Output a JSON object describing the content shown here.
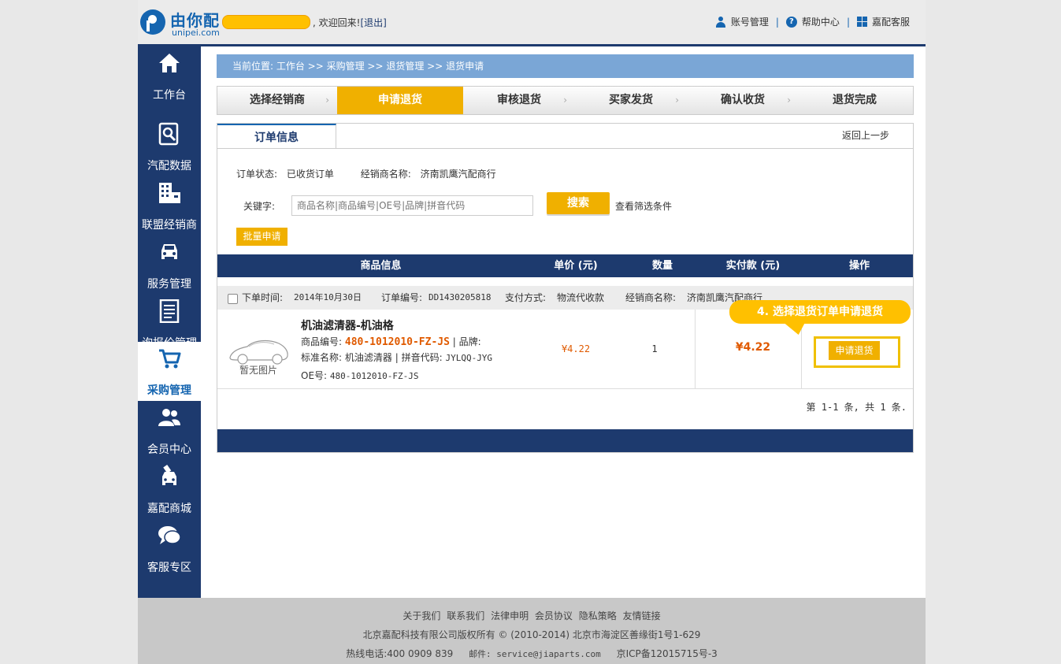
{
  "header": {
    "logo_text": "由你配",
    "logo_sub": "unipei.com",
    "welcome": ", 欢迎回来!",
    "logout": "[退出]",
    "links": [
      "账号管理",
      "帮助中心",
      "嘉配客服"
    ]
  },
  "sidebar": {
    "items": [
      {
        "label": "工作台",
        "icon": "home-icon"
      },
      {
        "label": "汽配数据",
        "icon": "search-doc-icon"
      },
      {
        "label": "联盟经销商",
        "icon": "building-icon"
      },
      {
        "label": "服务管理",
        "icon": "car-icon"
      },
      {
        "label": "询报价管理",
        "icon": "document-list-icon"
      },
      {
        "label": "采购管理",
        "icon": "cart-icon",
        "active": true
      },
      {
        "label": "会员中心",
        "icon": "users-icon"
      },
      {
        "label": "嘉配商城",
        "icon": "car-tag-icon"
      },
      {
        "label": "客服专区",
        "icon": "chat-icon"
      }
    ]
  },
  "breadcrumb": "当前位置: 工作台 >> 采购管理 >> 退货管理 >> 退货申请",
  "steps": [
    {
      "label": "选择经销商"
    },
    {
      "label": "申请退货",
      "active": true
    },
    {
      "label": "审核退货"
    },
    {
      "label": "买家发货"
    },
    {
      "label": "确认收货"
    },
    {
      "label": "退货完成"
    }
  ],
  "panel": {
    "tab": "订单信息",
    "back": "返回上一步",
    "status_label": "订单状态:",
    "status_value": "已收货订单",
    "dealer_label": "经销商名称:",
    "dealer_value": "济南凯鹰汽配商行",
    "keyword_label": "关键字:",
    "keyword_placeholder": "商品名称|商品编号|OE号|品牌|拼音代码",
    "search_btn": "搜索",
    "filter_link": "查看筛选条件",
    "batch_btn": "批量申请"
  },
  "table": {
    "headers": [
      "商品信息",
      "单价 (元)",
      "数量",
      "实付款 (元)",
      "操作"
    ]
  },
  "order": {
    "time_label": "下单时间:",
    "time_value": "2014年10月30日",
    "no_label": "订单编号:",
    "no_value": "DD1430205818",
    "pay_label": "支付方式:",
    "pay_value": "物流代收款",
    "dealer_label": "经销商名称:",
    "dealer_value": "济南凯鹰汽配商行"
  },
  "item": {
    "no_image": "暂无图片",
    "name": "机油滤清器-机油格",
    "code_label": "商品编号:",
    "code_value": "480-1012010-FZ-JS",
    "brand_label": "| 品牌:",
    "std_label": "标准名称:",
    "std_value": "机油滤清器",
    "pinyin_label": "| 拼音代码:",
    "pinyin_value": "JYLQQ-JYG",
    "oe_label": "OE号:",
    "oe_value": "480-1012010-FZ-JS",
    "price": "¥4.22",
    "qty": "1",
    "paid": "¥4.22",
    "action": "申请退货"
  },
  "callout": "4. 选择退货订单申请退货",
  "pager": "第 1-1 条, 共 1 条.",
  "footer": {
    "links": [
      "关于我们",
      "联系我们",
      "法律申明",
      "会员协议",
      "隐私策略",
      "友情链接"
    ],
    "copyright": "北京嘉配科技有限公司版权所有 © (2010-2014) 北京市海淀区善缘街1号1-629",
    "hotline": "热线电话:400 0909 839",
    "email": "邮件: service@jiaparts.com",
    "icp": "京ICP备12015715号-3"
  },
  "colors": {
    "navy": "#1d3a6e",
    "accent": "#f0b000",
    "link_blue": "#1565b0",
    "price_orange": "#e05a00"
  }
}
